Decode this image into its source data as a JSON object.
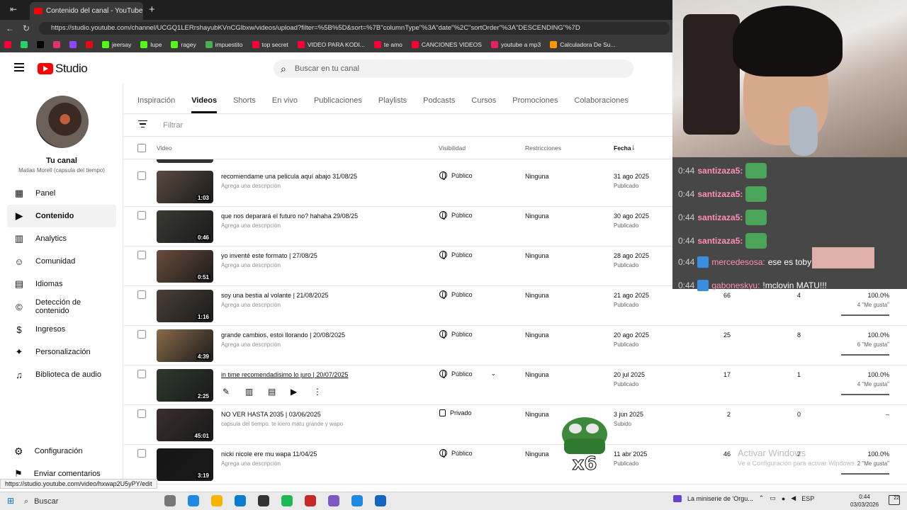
{
  "browser": {
    "tab_title": "Contenido del canal - YouTube Studio",
    "url": "https://studio.youtube.com/channel/UCGQ1LERrshayubKVnCGlbxw/videos/upload?filter=%5B%5D&sort=%7B\"columnType\"%3A\"date\"%2C\"sortOrder\"%3A\"DESCENDING\"%7D",
    "bookmarks": [
      {
        "label": "",
        "color": "#ff0033"
      },
      {
        "label": "",
        "color": "#25d366"
      },
      {
        "label": "",
        "color": "#000000"
      },
      {
        "label": "",
        "color": "#e1306c"
      },
      {
        "label": "",
        "color": "#9146ff"
      },
      {
        "label": "",
        "color": "#e50914"
      },
      {
        "label": "jeersay",
        "color": "#53fc18"
      },
      {
        "label": "lupe",
        "color": "#53fc18"
      },
      {
        "label": "ragey",
        "color": "#53fc18"
      },
      {
        "label": "impuestito",
        "color": "#4caf50"
      },
      {
        "label": "top secret",
        "color": "#ff0033"
      },
      {
        "label": "VIDEO PARA KODI...",
        "color": "#ff0033"
      },
      {
        "label": "te amo",
        "color": "#ff0033"
      },
      {
        "label": "CANCIONES VIDEOS",
        "color": "#ff0033"
      },
      {
        "label": "youtube a mp3",
        "color": "#e91e63"
      },
      {
        "label": "Calculadora De Su...",
        "color": "#ff9800"
      }
    ],
    "status_url": "https://studio.youtube.com/video/hxwap2U5yPY/edit"
  },
  "header": {
    "logo_text": "Studio",
    "search_placeholder": "Buscar en tu canal"
  },
  "sidebar": {
    "channel_title": "Tu canal",
    "channel_name": "Matias Morell (capsula del tiempo)",
    "items": [
      {
        "label": "Panel",
        "icon": "dashboard-icon"
      },
      {
        "label": "Contenido",
        "icon": "content-icon"
      },
      {
        "label": "Analytics",
        "icon": "analytics-icon"
      },
      {
        "label": "Comunidad",
        "icon": "community-icon"
      },
      {
        "label": "Idiomas",
        "icon": "subtitles-icon"
      },
      {
        "label": "Detección de contenido",
        "icon": "copyright-icon"
      },
      {
        "label": "Ingresos",
        "icon": "dollar-icon"
      },
      {
        "label": "Personalización",
        "icon": "magic-wand-icon"
      },
      {
        "label": "Biblioteca de audio",
        "icon": "audio-library-icon"
      }
    ],
    "settings_label": "Configuración",
    "feedback_label": "Enviar comentarios"
  },
  "content_tabs": [
    "Inspiración",
    "Videos",
    "Shorts",
    "En vivo",
    "Publicaciones",
    "Playlists",
    "Podcasts",
    "Cursos",
    "Promociones",
    "Colaboraciones"
  ],
  "filter_placeholder": "Filtrar",
  "columns": {
    "video": "Video",
    "visibility": "Visibilidad",
    "restrictions": "Restricciones",
    "date": "Fecha"
  },
  "videos": [
    {
      "title": "recomiendame una pelicula aquí abajo 31/08/25",
      "desc": "Agrega una descripción",
      "duration": "1:03",
      "visibility": "Público",
      "restrictions": "Ninguna",
      "date": "31 ago 2025",
      "status": "Publicado",
      "views": "",
      "comments": "",
      "likes": "",
      "likes_sub": ""
    },
    {
      "title": "que nos deparará el futuro no? hahaha 29/08/25",
      "desc": "Agrega una descripción",
      "duration": "0:46",
      "visibility": "Público",
      "restrictions": "Ninguna",
      "date": "30 ago 2025",
      "status": "Publicado",
      "views": "",
      "comments": "",
      "likes": "",
      "likes_sub": ""
    },
    {
      "title": "yo inventé este formato | 27/08/25",
      "desc": "Agrega una descripción",
      "duration": "0:51",
      "visibility": "Público",
      "restrictions": "Ninguna",
      "date": "28 ago 2025",
      "status": "Publicado",
      "views": "",
      "comments": "",
      "likes": "",
      "likes_sub": ""
    },
    {
      "title": "soy una bestia al volante | 21/08/2025",
      "desc": "Agrega una descripción",
      "duration": "1:16",
      "visibility": "Público",
      "restrictions": "Ninguna",
      "date": "21 ago 2025",
      "status": "Publicado",
      "views": "66",
      "comments": "4",
      "likes": "100.0%",
      "likes_sub": "4 \"Me gusta\""
    },
    {
      "title": "grande cambios, estoi llorando | 20/08/2025",
      "desc": "Agrega una descripción",
      "duration": "4:39",
      "visibility": "Público",
      "restrictions": "Ninguna",
      "date": "20 ago 2025",
      "status": "Publicado",
      "views": "25",
      "comments": "8",
      "likes": "100.0%",
      "likes_sub": "6 \"Me gusta\""
    },
    {
      "title": "in time recomendadisimo lo juro | 20/07/2025",
      "desc": "",
      "duration": "2:25",
      "visibility": "Público",
      "restrictions": "Ninguna",
      "date": "20 jul 2025",
      "status": "Publicado",
      "views": "17",
      "comments": "1",
      "likes": "100.0%",
      "likes_sub": "4 \"Me gusta\""
    },
    {
      "title": "NO VER HASTA 2035 | 03/06/2025",
      "desc": "capsula del tiempo. te kiero matu grande y wapo",
      "duration": "45:01",
      "visibility": "Privado",
      "restrictions": "Ninguna",
      "date": "3 jun 2025",
      "status": "Subido",
      "views": "2",
      "comments": "0",
      "likes": "–",
      "likes_sub": ""
    },
    {
      "title": "nicki nicole ere mu wapa 11/04/25",
      "desc": "Agrega una descripción",
      "duration": "3:19",
      "visibility": "Público",
      "restrictions": "Ninguna",
      "date": "11 abr 2025",
      "status": "Publicado",
      "views": "46",
      "comments": "2",
      "likes": "100.0%",
      "likes_sub": "2 \"Me gusta\""
    }
  ],
  "chat": [
    {
      "time": "0:44",
      "user": "santizaza5:",
      "msg": ""
    },
    {
      "time": "0:44",
      "user": "santizaza5:",
      "msg": ""
    },
    {
      "time": "0:44",
      "user": "santizaza5:",
      "msg": ""
    },
    {
      "time": "0:44",
      "user": "santizaza5:",
      "msg": ""
    },
    {
      "time": "0:44",
      "user": "mercedesosa:",
      "msg": "ese es toby"
    },
    {
      "time": "0:44",
      "user": "gaboneskyu:",
      "msg": "!mclovin MATU!!!"
    }
  ],
  "overlay": {
    "emote_count": "x6",
    "watermark_title": "Activar Windows",
    "watermark_sub": "Ve a Configuración para activar Windows."
  },
  "taskbar": {
    "search_label": "Buscar",
    "notification": "La miniserie de 'Orgu...",
    "lang": "ESP",
    "time": "0:44",
    "date": "03/03/2026",
    "badge": "22"
  }
}
